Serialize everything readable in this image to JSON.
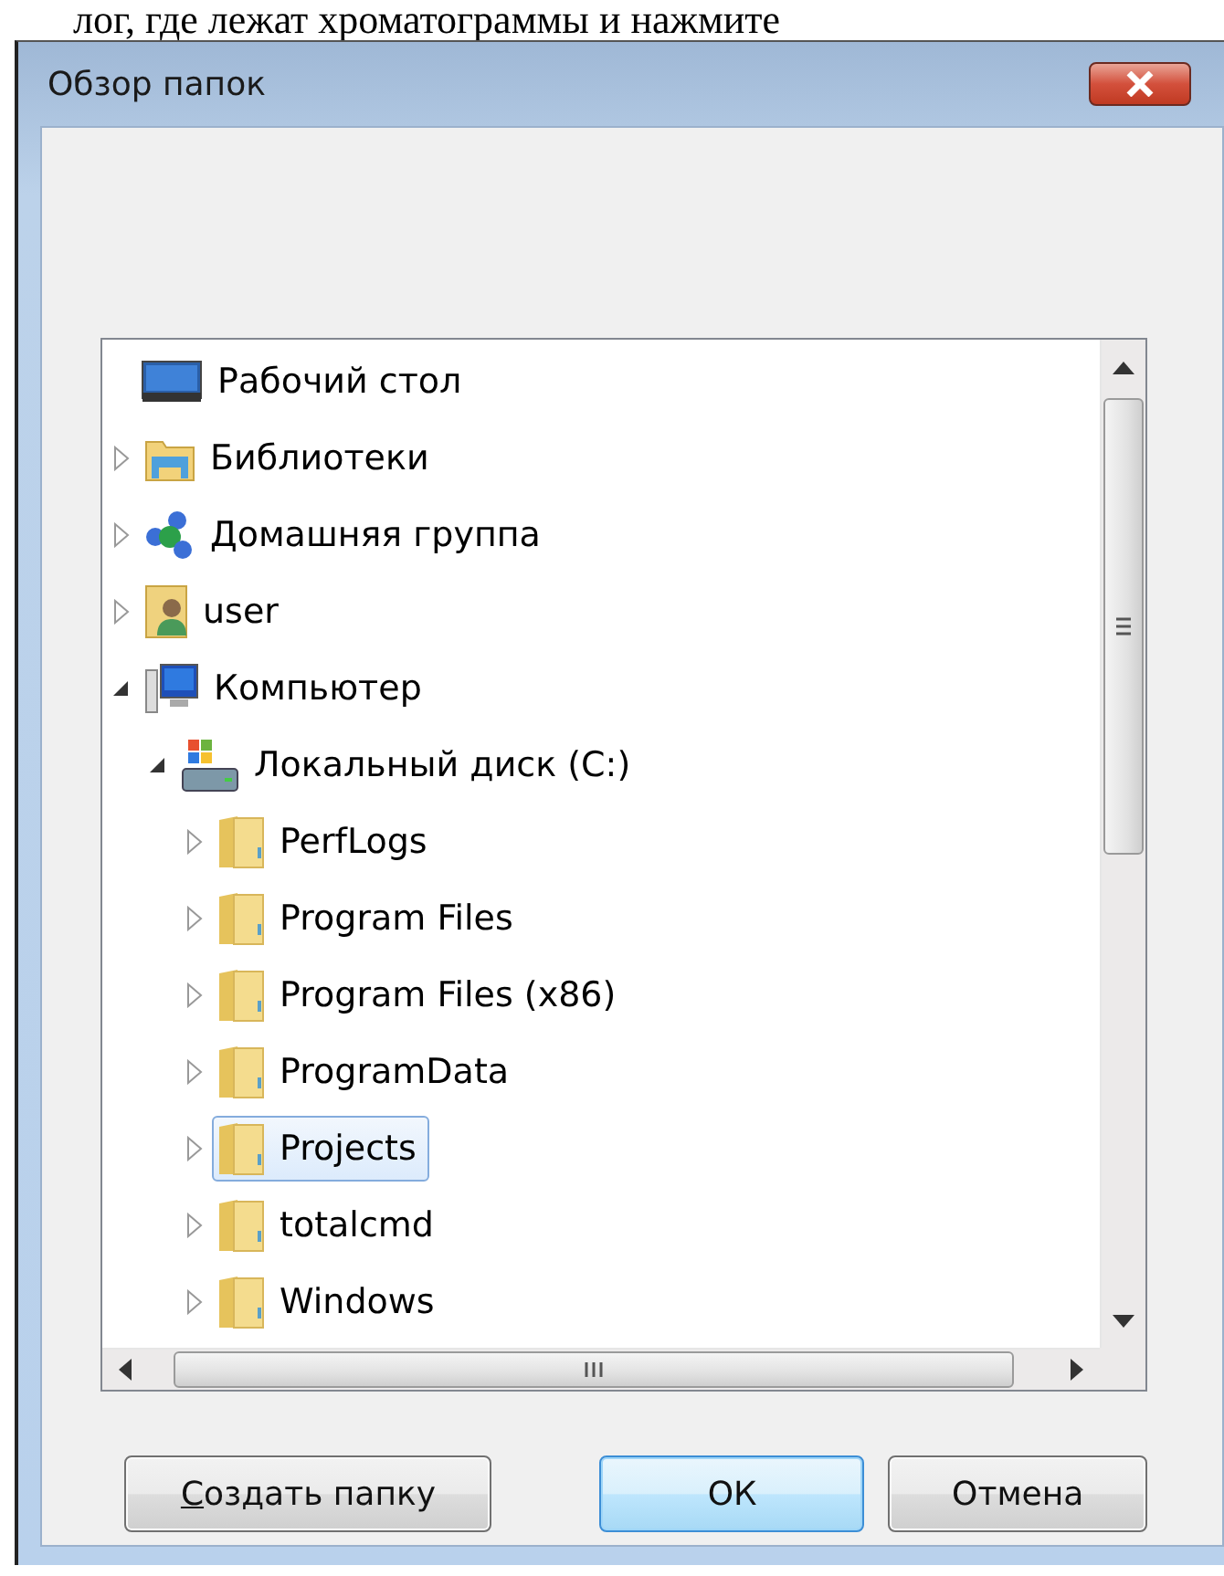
{
  "background_text": "лог, где лежат хроматограммы и нажмите",
  "window": {
    "title": "Обзор папок"
  },
  "tree": [
    {
      "label": "Рабочий стол",
      "kind": "desktop",
      "selected": false,
      "children": [
        {
          "label": "Библиотеки",
          "kind": "library",
          "expanded": false,
          "selected": false
        },
        {
          "label": "Домашняя группа",
          "kind": "homegroup",
          "expanded": false,
          "selected": false
        },
        {
          "label": "user",
          "kind": "user",
          "expanded": false,
          "selected": false
        },
        {
          "label": "Компьютер",
          "kind": "computer",
          "expanded": true,
          "selected": false,
          "children": [
            {
              "label": "Локальный диск (C:)",
              "kind": "drive",
              "expanded": true,
              "selected": false,
              "children": [
                {
                  "label": "PerfLogs",
                  "kind": "folder",
                  "expanded": false,
                  "selected": false
                },
                {
                  "label": "Program Files",
                  "kind": "folder",
                  "expanded": false,
                  "selected": false
                },
                {
                  "label": "Program Files (x86)",
                  "kind": "folder",
                  "expanded": false,
                  "selected": false
                },
                {
                  "label": "ProgramData",
                  "kind": "folder",
                  "expanded": false,
                  "selected": false
                },
                {
                  "label": "Projects",
                  "kind": "folder",
                  "expanded": false,
                  "selected": true
                },
                {
                  "label": "totalcmd",
                  "kind": "folder",
                  "expanded": false,
                  "selected": false
                },
                {
                  "label": "Windows",
                  "kind": "folder",
                  "expanded": false,
                  "selected": false
                }
              ]
            }
          ]
        }
      ]
    }
  ],
  "buttons": [
    {
      "label": "Создать папку",
      "underline_first": true,
      "default": false
    },
    {
      "label": "ОК",
      "underline_first": false,
      "default": true
    },
    {
      "label": "Отмена",
      "underline_first": false,
      "default": false
    }
  ]
}
